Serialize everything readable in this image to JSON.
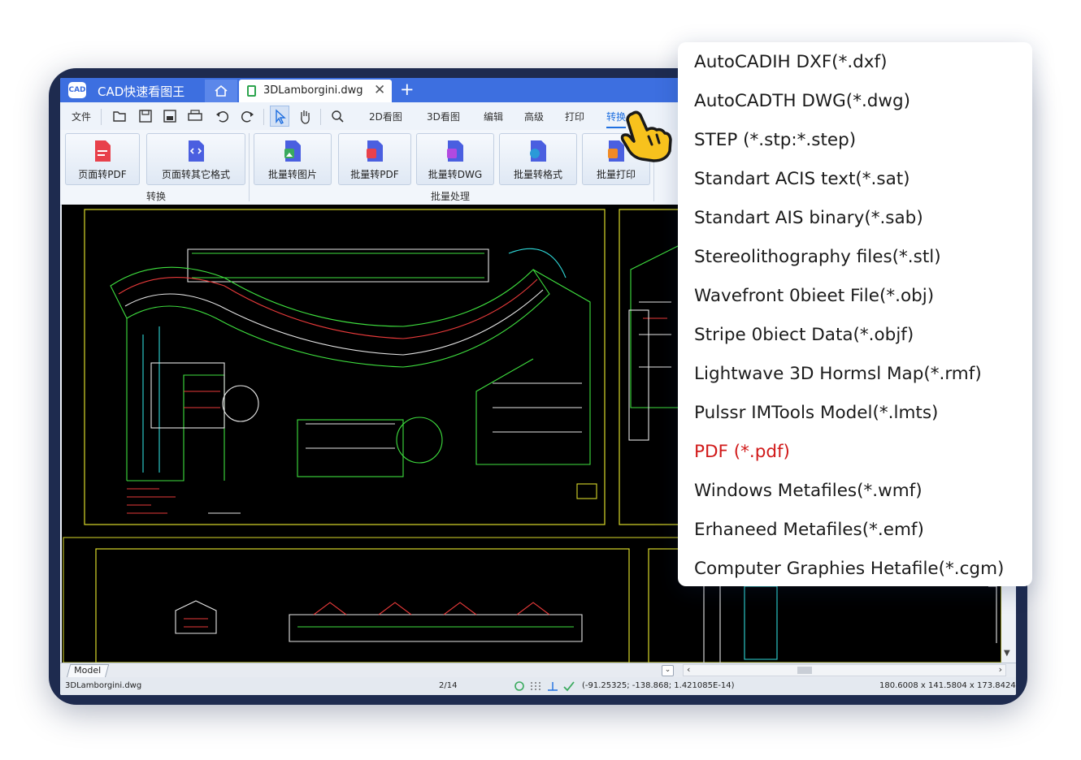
{
  "window": {
    "logo_text": "CAD",
    "app_title": "CAD快速看图王",
    "doc_tab": "3DLamborgini.dwg",
    "close_glyph": "✕",
    "add_glyph": "+"
  },
  "menu": {
    "file": "文件",
    "view2d": "2D看图",
    "view3d": "3D看图",
    "edit": "编辑",
    "advanced": "高级",
    "print": "打印",
    "convert": "转换"
  },
  "ribbon": {
    "buttons": [
      {
        "label": "页面转PDF",
        "color": "#e8414b"
      },
      {
        "label": "页面转其它格式",
        "color": "#4a5fe0"
      },
      {
        "label": "批量转图片",
        "color": "#3aaa5e"
      },
      {
        "label": "批量转PDF",
        "color": "#e8414b"
      },
      {
        "label": "批量转DWG",
        "color": "#b24ae0"
      },
      {
        "label": "批量转格式",
        "color": "#2a9ad8"
      },
      {
        "label": "批量打印",
        "color": "#f08a24"
      }
    ],
    "groups": [
      "转换",
      "批量处理"
    ]
  },
  "bottom": {
    "model_tab": "Model",
    "filename": "3DLamborgini.dwg",
    "page": "2/14",
    "coords": "(-91.25325; -138.868; 1.421085E-14)",
    "dimensions": "180.6008 x 141.5804 x 173.8424"
  },
  "dropdown": {
    "items": [
      "AutoCADIH DXF(*.dxf)",
      "AutoCADTH DWG(*.dwg)",
      "STEP (*.stp:*.step)",
      "Standart ACIS text(*.sat)",
      "Standart AIS binary(*.sab)",
      "Stereolithography files(*.stl)",
      "Wavefront 0bieet File(*.obj)",
      "Stripe 0biect Data(*.objf)",
      "Lightwave 3D Hormsl Map(*.rmf)",
      "Pulssr IMTools Model(*.lmts)",
      "PDF (*.pdf)",
      "Windows Metafiles(*.wmf)",
      "Erhaneed Metafiles(*.emf)",
      "Computer Graphies Hetafile(*.cgm)"
    ],
    "highlight_color": "#d11a1a"
  },
  "colors": {
    "frame": "#1e2b4f",
    "titlebar": "#3d6fe0",
    "accent": "#1f6fe0",
    "cad_bg": "#000000"
  }
}
